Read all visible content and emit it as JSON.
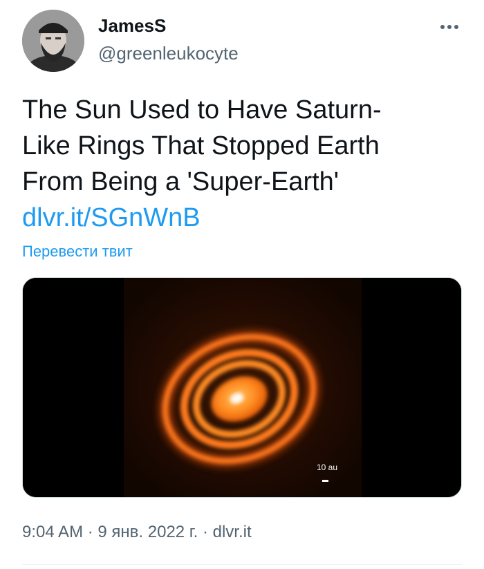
{
  "user": {
    "display_name": "JamesS",
    "handle": "@greenleukocyte"
  },
  "header": {
    "more_icon": "more-horizontal-icon"
  },
  "tweet": {
    "lines": [
      "The Sun Used to Have Saturn-",
      "Like Rings That Stopped Earth",
      "From Being a 'Super-Earth'"
    ],
    "link": "dlvr.it/SGnWnB",
    "translate_label": "Перевести твит"
  },
  "media": {
    "scale_label": "10 au"
  },
  "meta": {
    "time": "9:04 AM",
    "separator": " · ",
    "date": "9 янв. 2022 г.",
    "source": "dlvr.it"
  },
  "colors": {
    "accent": "#1d9bf0",
    "text": "#0f1419",
    "secondary": "#536471",
    "ring_orange": "#ff7a1a"
  }
}
